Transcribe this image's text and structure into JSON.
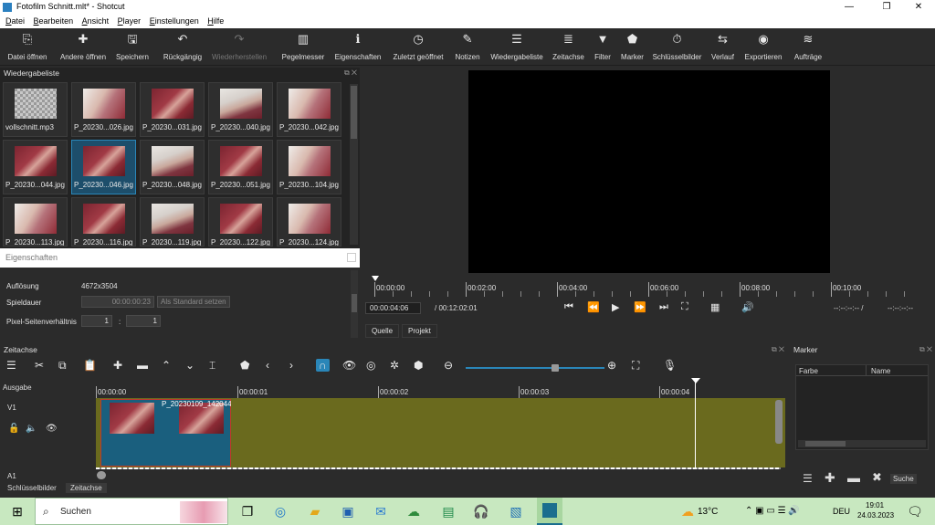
{
  "window": {
    "title": "Fotofilm Schnitt.mlt* - Shotcut",
    "minimize": "—",
    "maximize": "❐",
    "close": "✕"
  },
  "menu": [
    "Datei",
    "Bearbeiten",
    "Ansicht",
    "Player",
    "Einstellungen",
    "Hilfe"
  ],
  "toolbar": [
    {
      "label": "Datei öffnen",
      "icon": "folder-open-icon",
      "glyph": "⎘"
    },
    {
      "label": "Andere öffnen",
      "icon": "open-other-icon",
      "glyph": "✚"
    },
    {
      "label": "Speichern",
      "icon": "save-icon",
      "glyph": "🖫"
    },
    {
      "label": "Rückgängig",
      "icon": "undo-icon",
      "glyph": "↶"
    },
    {
      "label": "Wiederherstellen",
      "icon": "redo-icon",
      "glyph": "↷"
    },
    {
      "label": "Pegelmesser",
      "icon": "peak-meter-icon",
      "glyph": "▥"
    },
    {
      "label": "Eigenschaften",
      "icon": "properties-icon",
      "glyph": "ℹ"
    },
    {
      "label": "Zuletzt geöffnet",
      "icon": "recent-icon",
      "glyph": "◷"
    },
    {
      "label": "Notizen",
      "icon": "notes-icon",
      "glyph": "✎"
    },
    {
      "label": "Wiedergabeliste",
      "icon": "playlist-icon",
      "glyph": "☰"
    },
    {
      "label": "Zeitachse",
      "icon": "timeline-icon",
      "glyph": "≣"
    },
    {
      "label": "Filter",
      "icon": "filter-icon",
      "glyph": "▼"
    },
    {
      "label": "Marker",
      "icon": "marker-icon",
      "glyph": "⬟"
    },
    {
      "label": "Schlüsselbilder",
      "icon": "keyframes-icon",
      "glyph": "⏱"
    },
    {
      "label": "Verlauf",
      "icon": "history-icon",
      "glyph": "⇆"
    },
    {
      "label": "Exportieren",
      "icon": "export-icon",
      "glyph": "◉"
    },
    {
      "label": "Aufträge",
      "icon": "jobs-icon",
      "glyph": "≋"
    }
  ],
  "playlist": {
    "title": "Wiedergabeliste",
    "items": [
      {
        "name": "vollschnitt.mp3",
        "kind": "audio"
      },
      {
        "name": "P_20230...026.jpg",
        "kind": "photo"
      },
      {
        "name": "P_20230...031.jpg",
        "kind": "photo"
      },
      {
        "name": "P_20230...040.jpg",
        "kind": "photo"
      },
      {
        "name": "P_20230...042.jpg",
        "kind": "photo"
      },
      {
        "name": "P_20230...044.jpg",
        "kind": "photo"
      },
      {
        "name": "P_20230...046.jpg",
        "kind": "photo",
        "selected": true
      },
      {
        "name": "P_20230...048.jpg",
        "kind": "photo"
      },
      {
        "name": "P_20230...051.jpg",
        "kind": "photo"
      },
      {
        "name": "P_20230...104.jpg",
        "kind": "photo"
      },
      {
        "name": "P_20230...113.jpg",
        "kind": "photo"
      },
      {
        "name": "P_20230...116.jpg",
        "kind": "photo"
      },
      {
        "name": "P_20230...119.jpg",
        "kind": "photo"
      },
      {
        "name": "P_20230...122.jpg",
        "kind": "photo"
      },
      {
        "name": "P_20230...124.jpg",
        "kind": "photo"
      }
    ]
  },
  "properties": {
    "title": "Eigenschaften",
    "resolution_label": "Auflösung",
    "resolution_value": "4672x3504",
    "duration_label": "Spieldauer",
    "duration_value": "00:00:00:23",
    "set_default_button": "Als Standard setzen",
    "pixel_aspect_label": "Pixel-Seitenverhältnis",
    "aspect_num": "1",
    "aspect_sep": ":",
    "aspect_den": "1"
  },
  "player": {
    "ruler_labels": [
      "00:00:00",
      "00:02:00",
      "00:04:00",
      "00:06:00",
      "00:08:00",
      "00:10:00"
    ],
    "current_time": "00:00:04:06",
    "total_time": "/ 00:12:02:01",
    "in_point": "--:--:--:-- /",
    "out_point": "--:--:--:--",
    "tab_source": "Quelle",
    "tab_project": "Projekt"
  },
  "timeline": {
    "title": "Zeitachse",
    "output_label": "Ausgabe",
    "track_v1": "V1",
    "track_a1": "A1",
    "ruler_labels": [
      "00:00:00",
      "00:00:01",
      "00:00:02",
      "00:00:03",
      "00:00:04"
    ],
    "clip_name": "P_20230109_142044"
  },
  "marker_panel": {
    "title": "Marker",
    "col_color": "Farbe",
    "col_name": "Name",
    "search_button": "Suche"
  },
  "bottom_tabs": {
    "keyframes": "Schlüsselbilder",
    "timeline": "Zeitachse"
  },
  "taskbar": {
    "search_placeholder": "Suchen",
    "weather": "13°C",
    "language": "DEU",
    "time": "19:01",
    "date": "24.03.2023"
  },
  "colors": {
    "selection": "#1d4e6b",
    "track": "#6a6a1e",
    "clip": "#1a5f7e",
    "taskbar": "#c8e8c0"
  }
}
